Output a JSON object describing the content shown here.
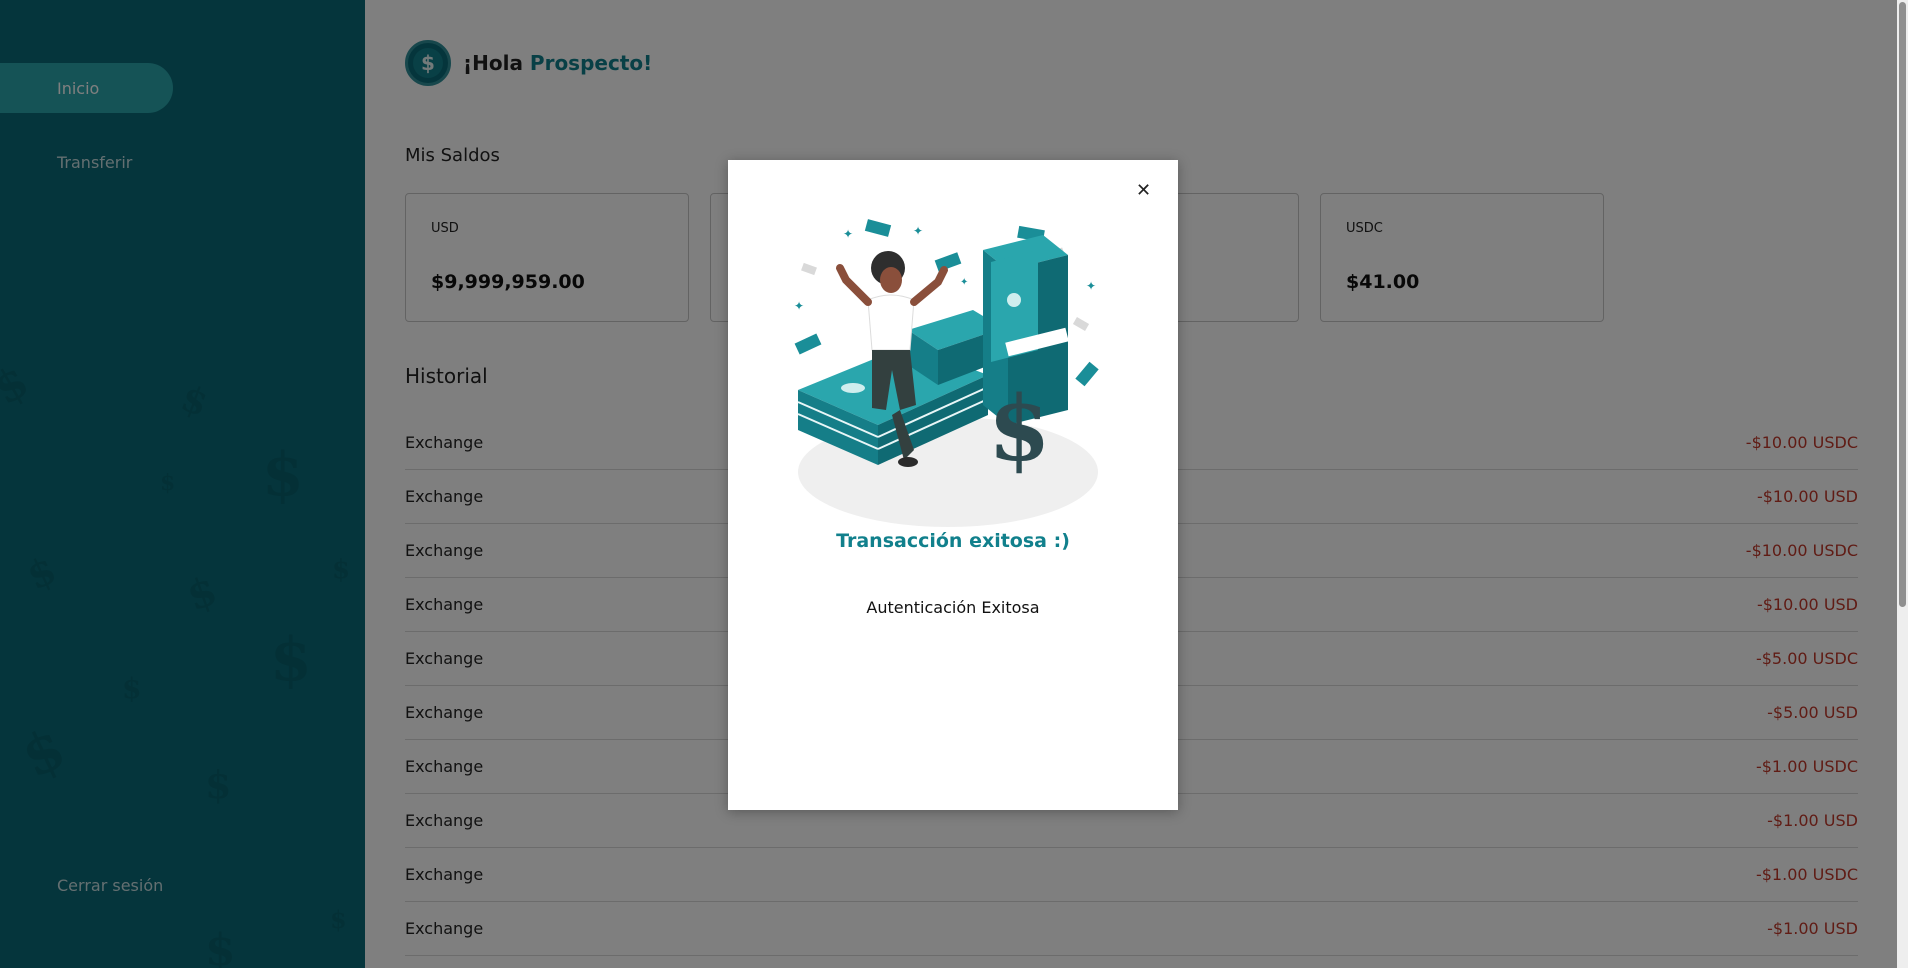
{
  "sidebar": {
    "items": [
      {
        "label": "Inicio"
      },
      {
        "label": "Transferir"
      }
    ],
    "logout_label": "Cerrar sesión"
  },
  "header": {
    "greeting": "¡Hola",
    "name": "Prospecto!"
  },
  "balances": {
    "title": "Mis Saldos",
    "cards": [
      {
        "currency": "USD",
        "amount": "$9,999,959.00"
      },
      {
        "currency": "",
        "amount": ""
      },
      {
        "currency": "",
        "amount": ""
      },
      {
        "currency": "USDC",
        "amount": "$41.00"
      }
    ]
  },
  "history": {
    "title": "Historial",
    "rows": [
      {
        "label": "Exchange",
        "amount": "-$10.00 USDC"
      },
      {
        "label": "Exchange",
        "amount": "-$10.00 USD"
      },
      {
        "label": "Exchange",
        "amount": "-$10.00 USDC"
      },
      {
        "label": "Exchange",
        "amount": "-$10.00 USD"
      },
      {
        "label": "Exchange",
        "amount": "-$5.00 USDC"
      },
      {
        "label": "Exchange",
        "amount": "-$5.00 USD"
      },
      {
        "label": "Exchange",
        "amount": "-$1.00 USDC"
      },
      {
        "label": "Exchange",
        "amount": "-$1.00 USD"
      },
      {
        "label": "Exchange",
        "amount": "-$1.00 USDC"
      },
      {
        "label": "Exchange",
        "amount": "-$1.00 USD"
      }
    ]
  },
  "modal": {
    "close_icon": "close-icon",
    "illustration_icon": "money-celebration-illustration",
    "title": "Transacción exitosa :)",
    "message": "Autenticación Exitosa"
  },
  "colors": {
    "sidebar": "#0a6b78",
    "accent": "#11808c",
    "active_nav": "#2aa6ad",
    "negative": "#c0392b"
  }
}
